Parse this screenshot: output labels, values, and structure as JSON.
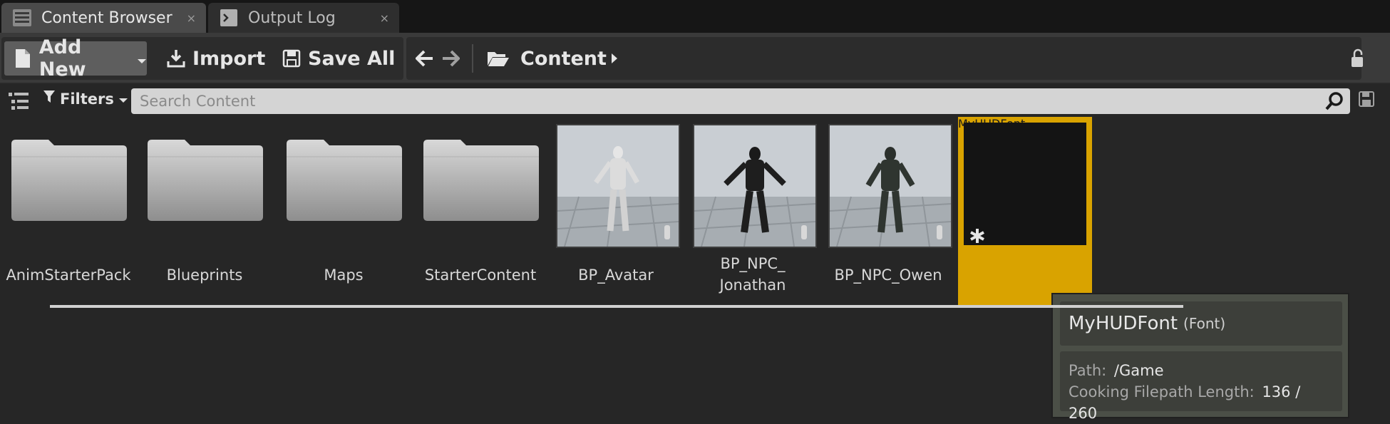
{
  "tabs": [
    {
      "label": "Content Browser",
      "icon": "content-browser-icon",
      "close": "×",
      "active": true
    },
    {
      "label": "Output Log",
      "icon": "output-log-icon",
      "close": "×",
      "active": false
    }
  ],
  "toolbar": {
    "add_new": "Add New",
    "import": "Import",
    "save_all": "Save All",
    "path_root": "Content"
  },
  "filter_bar": {
    "filters_label": "Filters",
    "search_placeholder": "Search Content"
  },
  "assets": [
    {
      "name": "AnimStarterPack",
      "kind": "folder"
    },
    {
      "name": "Blueprints",
      "kind": "folder"
    },
    {
      "name": "Maps",
      "kind": "folder"
    },
    {
      "name": "StarterContent",
      "kind": "folder"
    },
    {
      "name": "BP_Avatar",
      "kind": "blueprint"
    },
    {
      "name_line1": "BP_NPC_",
      "name_line2": "Jonathan",
      "kind": "blueprint"
    },
    {
      "name": "BP_NPC_Owen",
      "kind": "blueprint"
    },
    {
      "name": "MyHUDFont",
      "kind": "font",
      "selected": true
    }
  ],
  "tooltip": {
    "title": "MyHUDFont",
    "type": "(Font)",
    "path_label": "Path:",
    "path_value": "/Game",
    "cook_label": "Cooking Filepath Length:",
    "cook_value": "136 / 260"
  },
  "colors": {
    "selection": "#d9a300",
    "tooltip_bg": "#4b4f47"
  }
}
